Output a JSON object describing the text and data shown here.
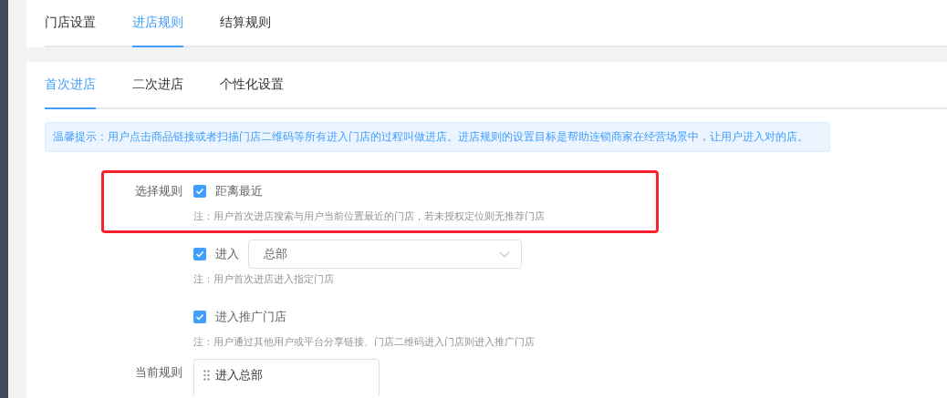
{
  "top_tabs": [
    {
      "label": "门店设置",
      "selected": false
    },
    {
      "label": "进店规则",
      "selected": true
    },
    {
      "label": "结算规则",
      "selected": false
    }
  ],
  "sub_tabs": [
    {
      "label": "首次进店",
      "selected": true
    },
    {
      "label": "二次进店",
      "selected": false
    },
    {
      "label": "个性化设置",
      "selected": false
    }
  ],
  "tip": "温馨提示：用户点击商品链接或者扫描门店二维码等所有进入门店的过程叫做进店。进店规则的设置目标是帮助连锁商家在经营场景中，让用户进入对的店。",
  "rule_section": {
    "label": "选择规则",
    "options": [
      {
        "kind": "plain",
        "label": "距离最近",
        "checked": true,
        "highlighted": true,
        "note": "注：用户首次进店搜索与用户当前位置最近的门店，若未授权定位则无推荐门店"
      },
      {
        "kind": "select",
        "label": "进入",
        "checked": true,
        "highlighted": false,
        "value": "总部",
        "note": "注：用户首次进店进入指定门店"
      },
      {
        "kind": "plain",
        "label": "进入推广门店",
        "checked": true,
        "highlighted": false,
        "note": "注：用户通过其他用户或平台分享链接、门店二维码进入门店则进入推广门店"
      }
    ]
  },
  "current_rule": {
    "label": "当前规则",
    "items": [
      "进入总部"
    ]
  }
}
